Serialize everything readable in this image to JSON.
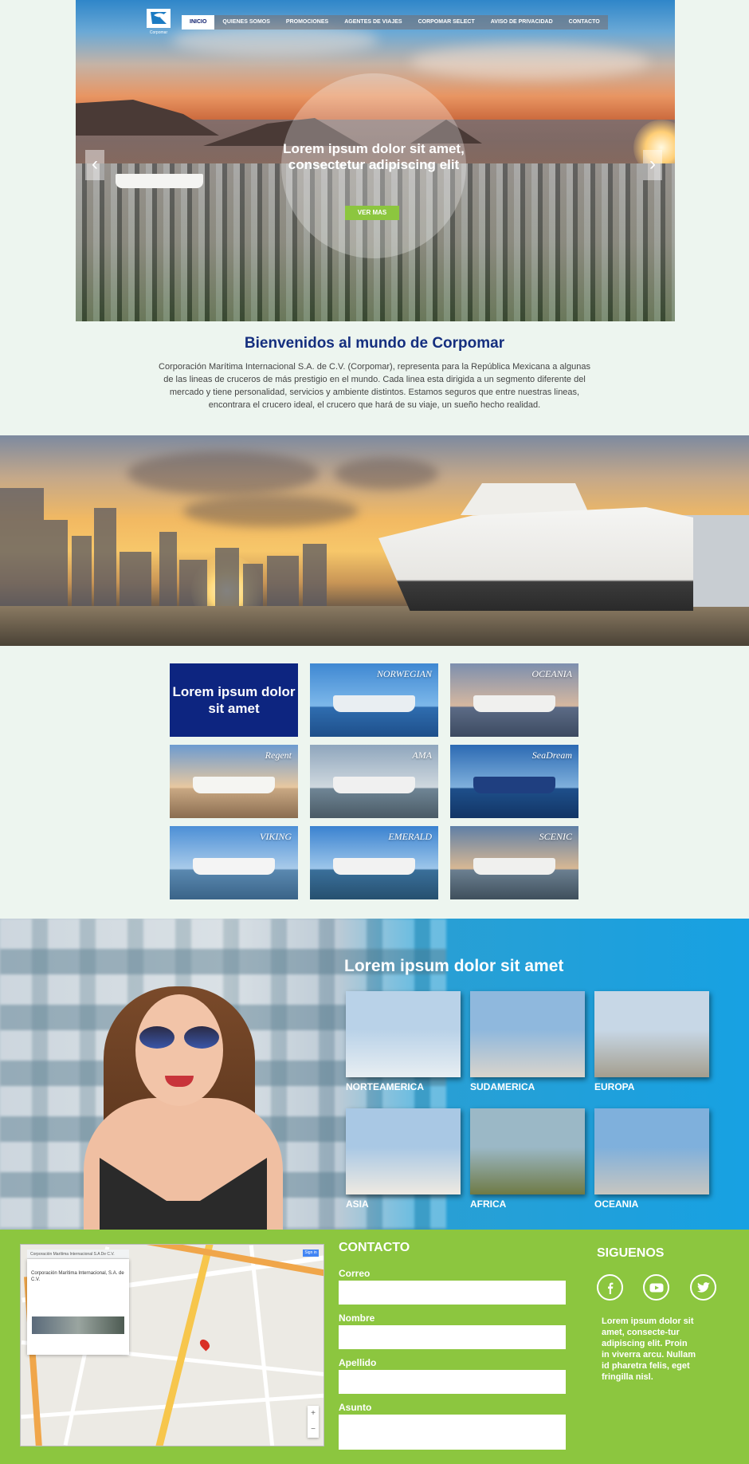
{
  "nav": {
    "logo_text": "Corpomar",
    "items": [
      {
        "label": "INICIO",
        "active": true
      },
      {
        "label": "QUIENES SOMOS",
        "active": false
      },
      {
        "label": "PROMOCIONES",
        "active": false
      },
      {
        "label": "AGENTES DE VIAJES",
        "active": false
      },
      {
        "label": "CORPOMAR SELECT",
        "active": false
      },
      {
        "label": "AVISO DE PRIVACIDAD",
        "active": false
      },
      {
        "label": "CONTACTO",
        "active": false
      }
    ]
  },
  "hero": {
    "title": "Lorem ipsum dolor sit amet, consectetur adipiscing elit",
    "button": "VER MAS",
    "prev_icon": "chevron-left-icon",
    "next_icon": "chevron-right-icon"
  },
  "welcome": {
    "title": "Bienvenidos al mundo de Corpomar",
    "text": "Corporación Marítima Internacional S.A. de C.V. (Corpomar), representa para la República Mexicana a algunas de las lineas de cruceros de más prestigio en el mundo. Cada linea esta dirigida a un segmento diferente del mercado y tiene personalidad, servicios y ambiente distintos. Estamos seguros que entre nuestras lineas, encontrara el crucero ideal, el crucero que hará de su viaje, un sueño hecho realidad."
  },
  "cruises": {
    "highlight": "Lorem ipsum dolor sit amet",
    "lines": [
      {
        "brand": "NORWEGIAN",
        "sky": "#3f88d2",
        "sky2": "#7db8ea",
        "sea": "#2f6db0",
        "sea2": "#1e4f8a",
        "ship": "#e9eef2"
      },
      {
        "brand": "OCEANIA",
        "sky": "#7d8fae",
        "sky2": "#d6b8a0",
        "sea": "#5c6b86",
        "sea2": "#3c4a60",
        "ship": "#f0f0ee"
      },
      {
        "brand": "Regent",
        "sky": "#6d9bd0",
        "sky2": "#e8c8a0",
        "sea": "#c9a883",
        "sea2": "#8a6d50",
        "ship": "#f5f5f2"
      },
      {
        "brand": "AMA",
        "sky": "#8fa6bd",
        "sky2": "#cfd8de",
        "sea": "#6f8595",
        "sea2": "#4a5a65",
        "ship": "#f0f0f0"
      },
      {
        "brand": "SeaDream",
        "sky": "#2c6ab3",
        "sky2": "#7fb0dc",
        "sea": "#1e4f8a",
        "sea2": "#123566",
        "ship": "#1f3f80"
      },
      {
        "brand": "VIKING",
        "sky": "#4c8fd6",
        "sky2": "#a9cbea",
        "sea": "#5a88b0",
        "sea2": "#3a6488",
        "ship": "#f4f4f4"
      },
      {
        "brand": "EMERALD",
        "sky": "#3a82d0",
        "sky2": "#9dc6ea",
        "sea": "#3a6f9a",
        "sea2": "#26506f",
        "ship": "#f2f2f2"
      },
      {
        "brand": "SCENIC",
        "sky": "#5f7fa6",
        "sky2": "#d8b894",
        "sea": "#6b7f90",
        "sea2": "#3f4f5c",
        "ship": "#f0f0ee"
      }
    ]
  },
  "destinations": {
    "title": "Lorem ipsum dolor sit amet",
    "items": [
      {
        "label": "NORTEAMERICA",
        "top": "#b9d2e8",
        "bottom": "#e8eef2"
      },
      {
        "label": "SUDAMERICA",
        "top": "#8fb8dd",
        "bottom": "#d9d4cc"
      },
      {
        "label": "EUROPA",
        "top": "#c7d7e6",
        "bottom": "#a49e8e"
      },
      {
        "label": "ASIA",
        "top": "#a9c8e4",
        "bottom": "#efeae2"
      },
      {
        "label": "AFRICA",
        "top": "#9bb8c6",
        "bottom": "#6f7a45"
      },
      {
        "label": "OCEANIA",
        "top": "#7fb0dc",
        "bottom": "#c8c6c0"
      }
    ]
  },
  "footer": {
    "map_search": "Corporación Marítima Internacional S.A De C.V.",
    "map_place": "Corporación Marítima Internacional, S.A. de C.V.",
    "map_signin": "Sign in",
    "contact_title": "CONTACTO",
    "fields": [
      {
        "label": "Correo",
        "value": ""
      },
      {
        "label": "Nombre",
        "value": ""
      },
      {
        "label": "Apellido",
        "value": ""
      },
      {
        "label": "Asunto",
        "value": ""
      }
    ],
    "follow_title": "SIGUENOS",
    "social": [
      "facebook-icon",
      "youtube-icon",
      "twitter-icon"
    ],
    "text": "Lorem ipsum dolor sit amet, consecte-tur adipiscing elit. Proin in viverra arcu. Nullam id pharetra felis, eget fringilla nisl."
  }
}
